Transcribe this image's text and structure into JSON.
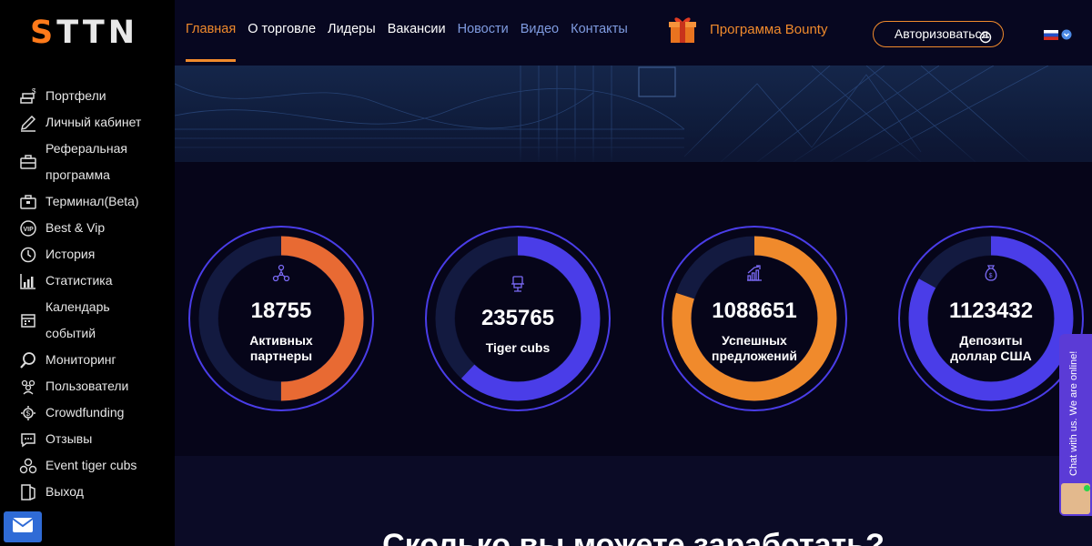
{
  "brand": {
    "logo_first": "S",
    "logo_rest": "TTN",
    "accent": "#f08a2c"
  },
  "sidebar": {
    "items": [
      {
        "label": "Портфели",
        "icon": "portfolio-coins-icon"
      },
      {
        "label": "Личный кабинет",
        "icon": "pencil-icon"
      },
      {
        "label_line1": "Реферальная",
        "label_line2": "программа",
        "icon": "briefcase-icon"
      },
      {
        "label": "Терминал(Beta)",
        "icon": "terminal-briefcase-icon"
      },
      {
        "label": "Best & Vip",
        "icon": "vip-badge-icon"
      },
      {
        "label": "История",
        "icon": "history-clock-icon"
      },
      {
        "label": "Статистика",
        "icon": "statistics-chart-icon"
      },
      {
        "label_line1": "Календарь",
        "label_line2": "событий",
        "icon": "calendar-icon"
      },
      {
        "label": "Мониторинг",
        "icon": "magnifier-icon"
      },
      {
        "label": "Пользователи",
        "icon": "users-icon"
      },
      {
        "label": "Crowdfunding",
        "icon": "crowdfunding-icon"
      },
      {
        "label": "Отзывы",
        "icon": "reviews-chat-icon"
      },
      {
        "label": "Event tiger cubs",
        "icon": "event-icon"
      },
      {
        "label": "Выход",
        "icon": "exit-door-icon"
      }
    ]
  },
  "nav": {
    "items": [
      {
        "label": "Главная",
        "state": "active"
      },
      {
        "label": "О торговле",
        "state": "white"
      },
      {
        "label": "Лидеры",
        "state": "white"
      },
      {
        "label": "Вакансии",
        "state": "white"
      },
      {
        "label": "Новости",
        "state": "blue"
      },
      {
        "label": "Видео",
        "state": "blue"
      },
      {
        "label": "Контакты",
        "state": "blue"
      }
    ],
    "bounty_label": "Программа Bounty",
    "auth_label": "Авторизоваться",
    "language": "ru"
  },
  "stats": [
    {
      "value": "18755",
      "label_line1": "Активных",
      "label_line2": "партнеры",
      "icon": "network-nodes-icon",
      "fraction": 0.5,
      "color": "#e86a33"
    },
    {
      "value": "235765",
      "label_line1": "Tiger cubs",
      "label_line2": "",
      "icon": "chair-icon",
      "fraction": 0.62,
      "color": "#4a3de8"
    },
    {
      "value": "1088651",
      "label_line1": "Успешных",
      "label_line2": "предложений",
      "icon": "growth-chart-icon",
      "fraction": 0.8,
      "color": "#f08a2c"
    },
    {
      "value": "1123432",
      "label_line1": "Депозиты",
      "label_line2": "доллар США",
      "icon": "money-bag-icon",
      "fraction": 0.83,
      "color": "#4a3de8"
    }
  ],
  "bottom": {
    "title": "Сколько вы можете заработать?"
  },
  "chat": {
    "text": "Chat with us. We are online!"
  }
}
